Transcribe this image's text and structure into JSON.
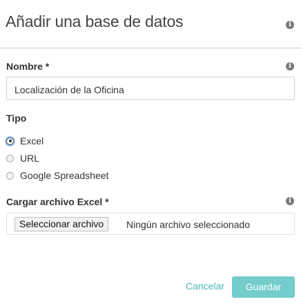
{
  "dialog": {
    "title": "Añadir una base de datos"
  },
  "form": {
    "name": {
      "label": "Nombre *",
      "value": "Localización de la Oficina"
    },
    "type": {
      "label": "Tipo",
      "options": [
        {
          "label": "Excel",
          "selected": true
        },
        {
          "label": "URL",
          "selected": false
        },
        {
          "label": "Google Spreadsheet",
          "selected": false
        }
      ]
    },
    "file": {
      "label": "Cargar archivo Excel *",
      "button_label": "Seleccionar archivo",
      "status": "Ningún archivo seleccionado"
    }
  },
  "actions": {
    "cancel_label": "Cancelar",
    "save_label": "Guardar"
  },
  "icons": {
    "info_glyph": "i"
  },
  "colors": {
    "accent": "#4ab5b5",
    "save_button": "#74cccb",
    "info_icon": "#7a7a7a"
  }
}
